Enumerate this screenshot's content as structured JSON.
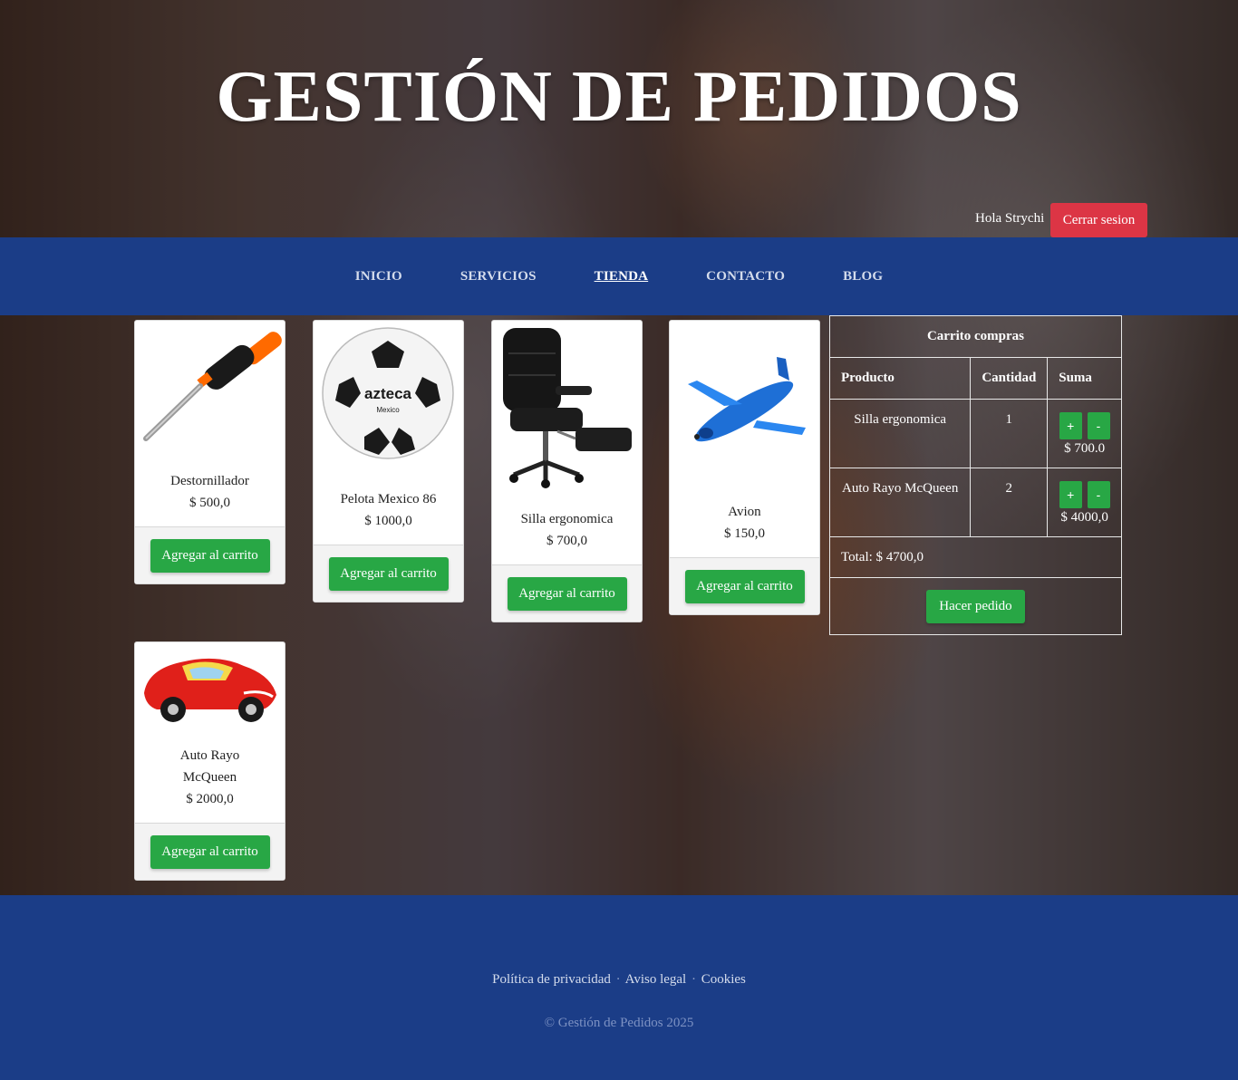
{
  "header": {
    "title": "GESTIÓN DE PEDIDOS",
    "greeting": "Hola Strychi",
    "logout_label": "Cerrar sesion"
  },
  "nav": {
    "items": [
      {
        "label": "INICIO",
        "active": false
      },
      {
        "label": "SERVICIOS",
        "active": false
      },
      {
        "label": "TIENDA",
        "active": true
      },
      {
        "label": "CONTACTO",
        "active": false
      },
      {
        "label": "BLOG",
        "active": false
      }
    ]
  },
  "products": [
    {
      "name": "Destornillador",
      "price": "$ 500,0",
      "button": "Agregar al carrito",
      "image": "screwdriver"
    },
    {
      "name": "Pelota Mexico 86",
      "price": "$ 1000,0",
      "button": "Agregar al carrito",
      "image": "soccer-ball",
      "ball_text": "azteca",
      "ball_subtext": "Mexico"
    },
    {
      "name": "Silla ergonomica",
      "price": "$ 700,0",
      "button": "Agregar al carrito",
      "image": "office-chair"
    },
    {
      "name": "Avion",
      "price": "$ 150,0",
      "button": "Agregar al carrito",
      "image": "airplane"
    },
    {
      "name": "Auto Rayo McQueen",
      "price": "$ 2000,0",
      "button": "Agregar al carrito",
      "image": "toy-car"
    }
  ],
  "cart": {
    "title": "Carrito compras",
    "headers": [
      "Producto",
      "Cantidad",
      "Suma"
    ],
    "rows": [
      {
        "product": "Silla ergonomica",
        "qty": "1",
        "sum": "$ 700.0"
      },
      {
        "product": "Auto Rayo McQueen",
        "qty": "2",
        "sum": "$ 4000,0"
      }
    ],
    "plus_label": "+",
    "minus_label": "-",
    "total": "Total: $ 4700,0",
    "order_button": "Hacer pedido"
  },
  "footer": {
    "links": [
      "Política de privacidad",
      "Aviso legal",
      "Cookies"
    ],
    "separator": "·",
    "copyright": "© Gestión de Pedidos 2025"
  },
  "colors": {
    "brand_blue": "#1b3d87",
    "success_green": "#28a745",
    "danger_red": "#dc3545"
  }
}
